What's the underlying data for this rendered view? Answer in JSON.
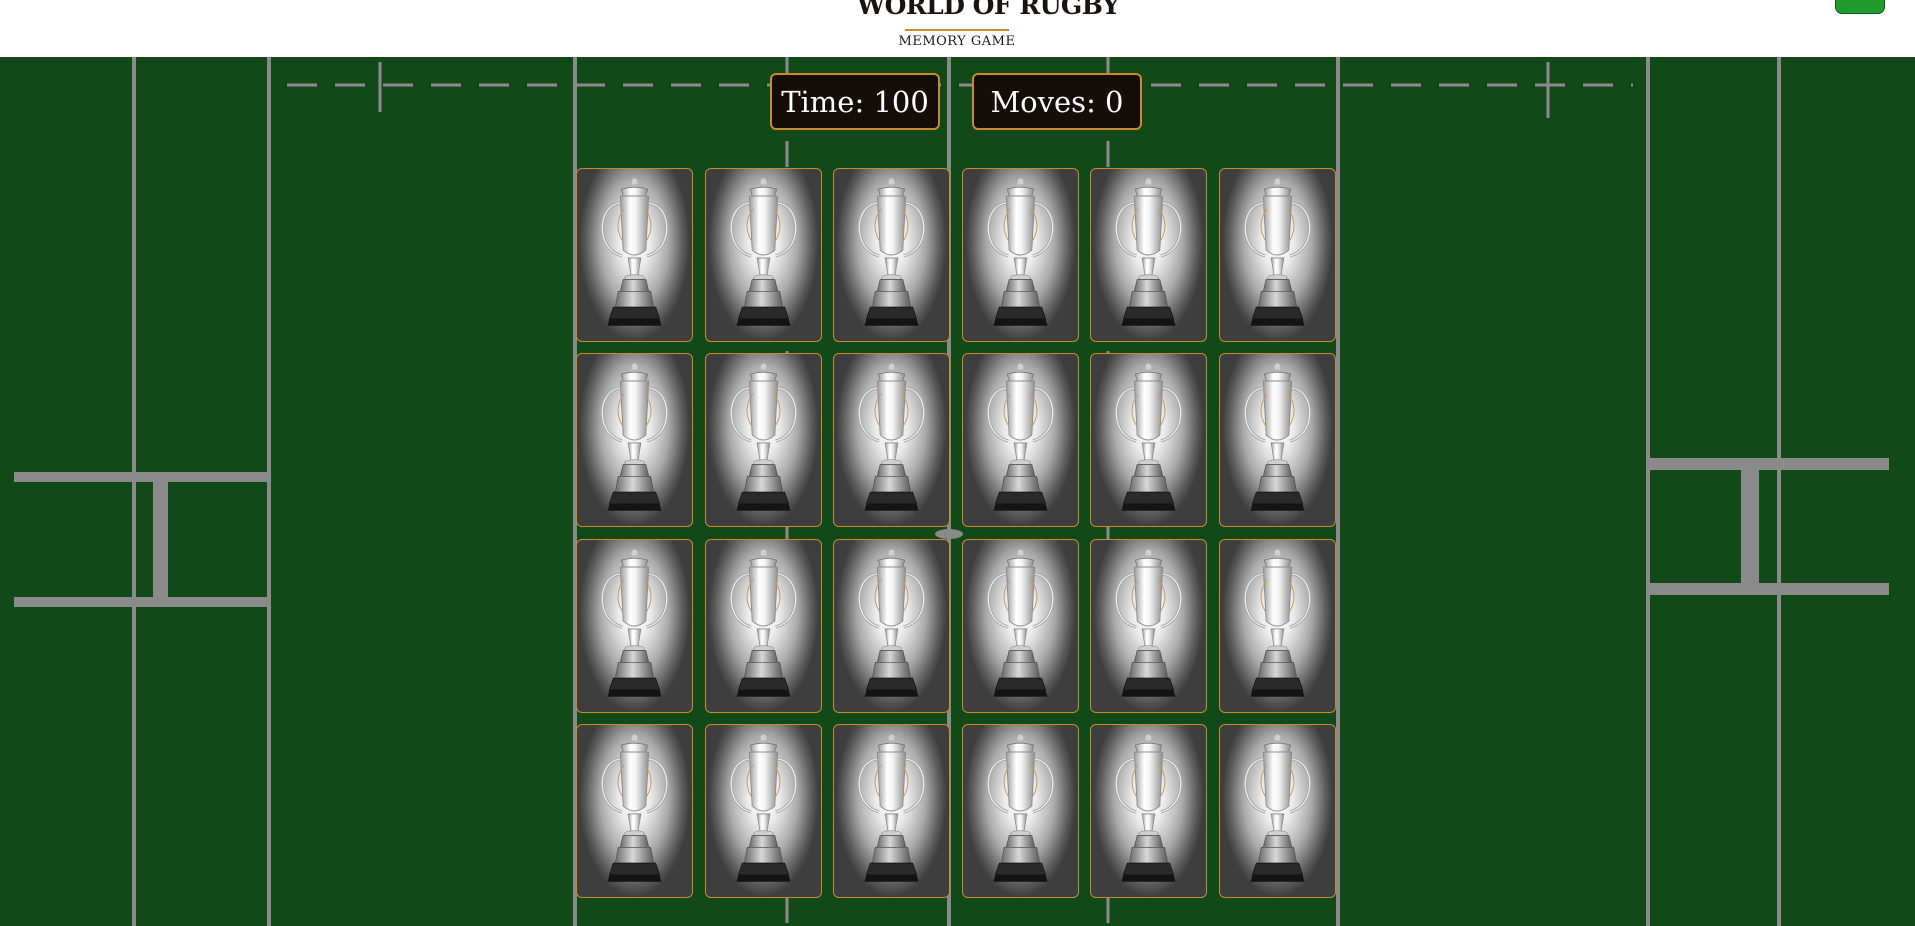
{
  "header": {
    "logo_title": "WORLD OF RUGBY",
    "logo_subtitle": "MEMORY GAME"
  },
  "stats": {
    "time_label": "Time: 100",
    "moves_label": "Moves: 0"
  },
  "board": {
    "rows": 4,
    "columns": 6,
    "card_back_icon": "trophy-icon",
    "card_state": "face-down"
  },
  "colors": {
    "pitch": "#114a18",
    "accent": "#c98a2c",
    "menu_button": "#1f9a2e",
    "counter_bg": "#150d08"
  }
}
